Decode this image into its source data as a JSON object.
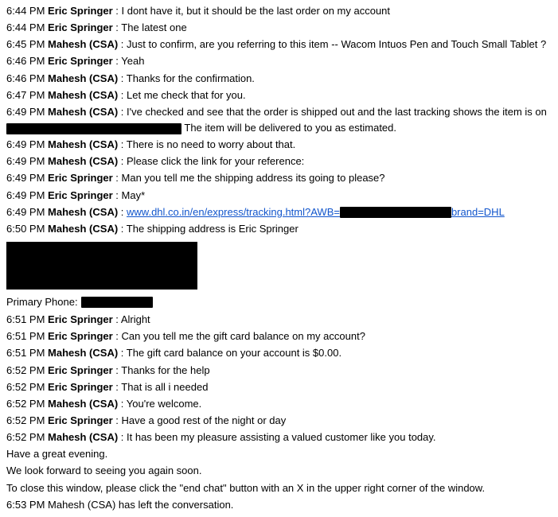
{
  "chat": {
    "lines": [
      {
        "time": "6:44 PM",
        "speaker": "Eric Springer",
        "text": "I dont have it, but it should be the last order on my account"
      },
      {
        "time": "6:44 PM",
        "speaker": "Eric Springer",
        "text": "The latest one"
      },
      {
        "time": "6:45 PM",
        "speaker": "Mahesh (CSA)",
        "text": "Just to confirm, are you referring to this item -- Wacom Intuos Pen and Touch Small Tablet ?"
      },
      {
        "time": "6:46 PM",
        "speaker": "Eric Springer",
        "text": "Yeah"
      },
      {
        "time": "6:46 PM",
        "speaker": "Mahesh (CSA)",
        "text": "Thanks for the confirmation."
      },
      {
        "time": "6:47 PM",
        "speaker": "Mahesh (CSA)",
        "text": "Let me check that for you."
      },
      {
        "time": "6:49 PM",
        "speaker": "Mahesh (CSA)",
        "text": "I've checked and see that the order is shipped out and the last tracking shows the item is on"
      },
      {
        "time": "6:49 PM",
        "speaker": "Mahesh (CSA)",
        "text": "There is no need to worry about that."
      },
      {
        "time": "6:49 PM",
        "speaker": "Mahesh (CSA)",
        "text": "Please click the link for your reference:"
      },
      {
        "time": "6:49 PM",
        "speaker": "Eric Springer",
        "text": "Man you tell me the shipping address its going to please?"
      },
      {
        "time": "6:49 PM",
        "speaker": "Eric Springer",
        "text": "May*"
      },
      {
        "time": "6:49 PM",
        "speaker": "Mahesh (CSA)",
        "text_pre": "www.dhl.co.in/en/express/tracking.html?AWB=",
        "text_post": "brand=DHL"
      },
      {
        "time": "6:50 PM",
        "speaker": "Mahesh (CSA)",
        "text": "The shipping address is Eric Springer"
      }
    ],
    "phone_label": "Primary Phone:",
    "lines2": [
      {
        "time": "6:51 PM",
        "speaker": "Eric Springer",
        "text": "Alright"
      },
      {
        "time": "6:51 PM",
        "speaker": "Eric Springer",
        "text": "Can you tell me the gift card balance on my account?"
      },
      {
        "time": "6:51 PM",
        "speaker": "Mahesh (CSA)",
        "text": "The gift card balance on your account is $0.00."
      },
      {
        "time": "6:52 PM",
        "speaker": "Eric Springer",
        "text": "Thanks for the help"
      },
      {
        "time": "6:52 PM",
        "speaker": "Eric Springer",
        "text": "That is all i needed"
      },
      {
        "time": "6:52 PM",
        "speaker": "Mahesh (CSA)",
        "text": "You're welcome."
      },
      {
        "time": "6:52 PM",
        "speaker": "Eric Springer",
        "text": "Have a good rest of the night or day"
      },
      {
        "time": "6:52 PM",
        "speaker": "Mahesh (CSA)",
        "text": "It has been my pleasure assisting a valued customer like you today."
      },
      {
        "time": "",
        "speaker": "",
        "text": "Have a great evening."
      },
      {
        "time": "",
        "speaker": "",
        "text": "We look forward to seeing you again soon."
      }
    ],
    "closing": "To close this window, please click the \"end chat\" button with an X in the upper right corner of the window.",
    "left": "6:53 PM Mahesh (CSA) has left the conversation."
  }
}
